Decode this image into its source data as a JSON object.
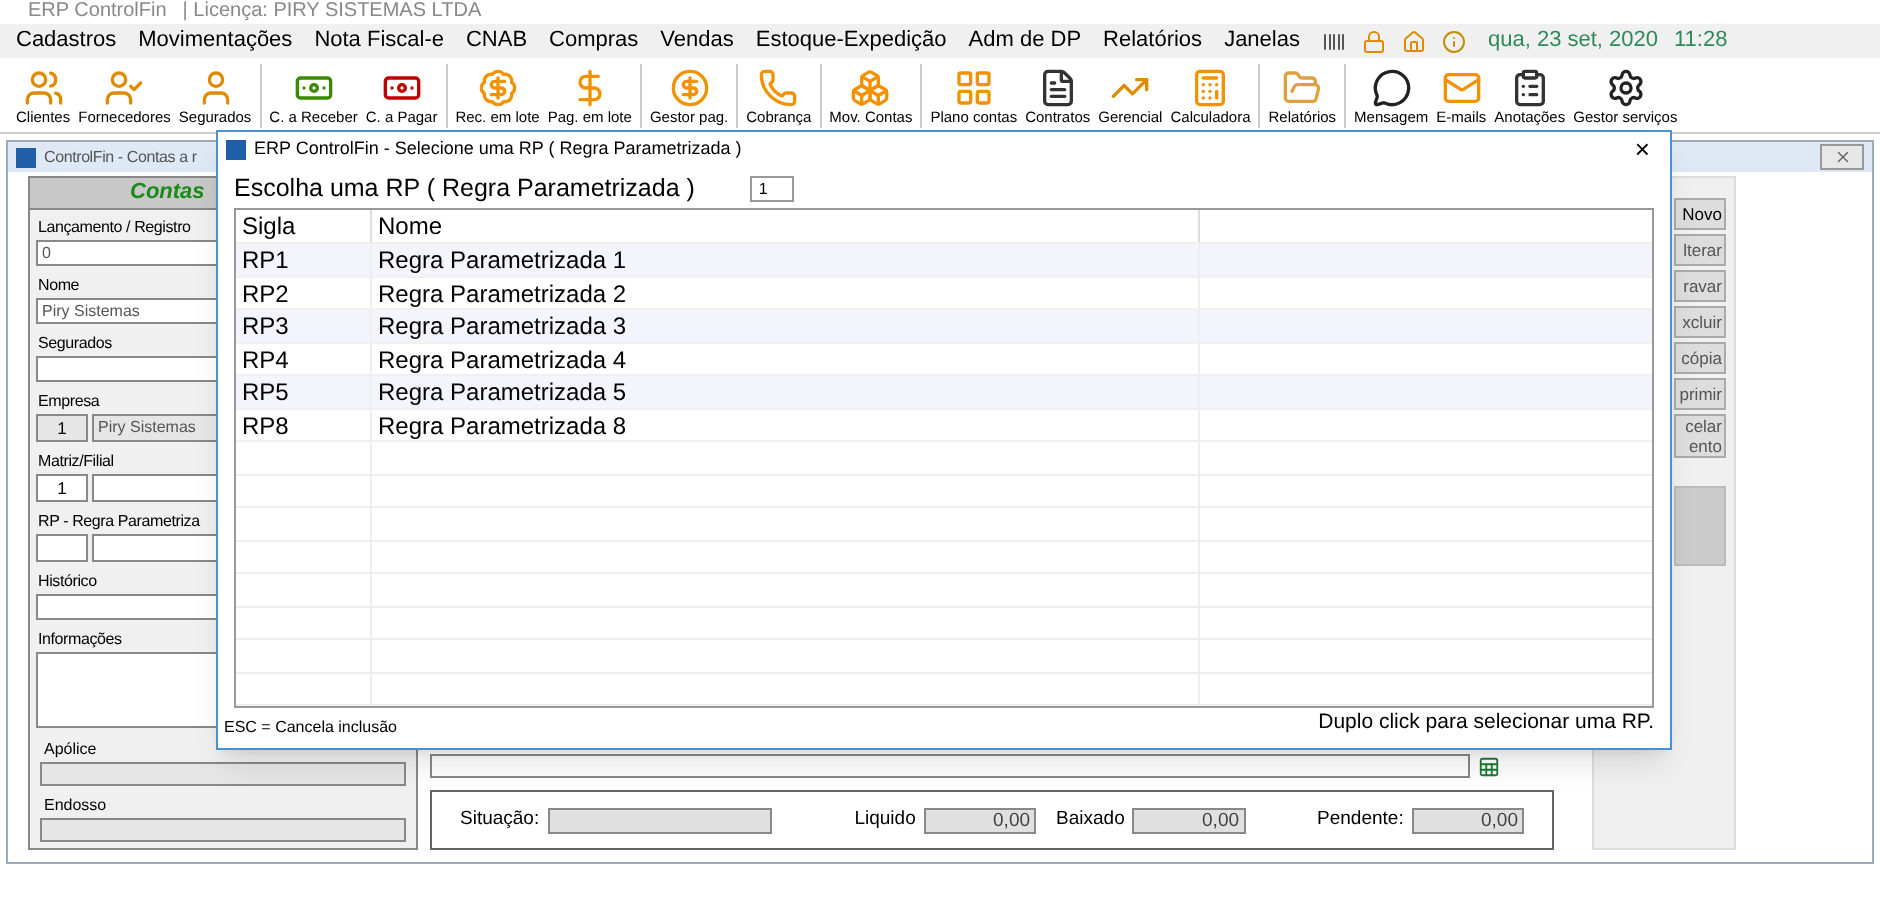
{
  "app": {
    "title": "ERP ControlFin",
    "license": "| Licença: PIRY SISTEMAS LTDA"
  },
  "menu": [
    "Cadastros",
    "Movimentações",
    "Nota Fiscal-e",
    "CNAB",
    "Compras",
    "Vendas",
    "Estoque-Expedição",
    "Adm de DP",
    "Relatórios",
    "Janelas"
  ],
  "datetime": {
    "date": "qua, 23 set, 2020",
    "time": "11:28"
  },
  "toolbar": [
    {
      "label": "Clientes",
      "separator_before": false
    },
    {
      "label": "Fornecedores",
      "separator_before": false
    },
    {
      "label": "Segurados",
      "separator_before": false
    },
    {
      "label": "C. a Receber",
      "separator_before": true
    },
    {
      "label": "C. a Pagar",
      "separator_before": false
    },
    {
      "label": "Rec. em lote",
      "separator_before": true
    },
    {
      "label": "Pag. em lote",
      "separator_before": false
    },
    {
      "label": "Gestor pag.",
      "separator_before": true
    },
    {
      "label": "Cobrança",
      "separator_before": true
    },
    {
      "label": "Mov. Contas",
      "separator_before": true
    },
    {
      "label": "Plano contas",
      "separator_before": true
    },
    {
      "label": "Contratos",
      "separator_before": false
    },
    {
      "label": "Gerencial",
      "separator_before": false
    },
    {
      "label": "Calculadora",
      "separator_before": false
    },
    {
      "label": "Relatórios",
      "separator_before": true
    },
    {
      "label": "Mensagem",
      "separator_before": true
    },
    {
      "label": "E-mails",
      "separator_before": false
    },
    {
      "label": "Anotações",
      "separator_before": false
    },
    {
      "label": "Gestor serviços",
      "separator_before": false
    }
  ],
  "child_window": {
    "title": "ControlFin -  Contas a r",
    "header": "Contas",
    "fields": [
      {
        "label": "Lançamento / Registro",
        "kind": "text",
        "value": "0",
        "disabled": false
      },
      {
        "label": "Nome",
        "kind": "text",
        "value": "Piry Sistemas",
        "disabled": false
      },
      {
        "label": "Segurados",
        "kind": "text",
        "disabled": false
      },
      {
        "label": "Empresa",
        "kind": "pair",
        "code": "1",
        "value": "Piry Sistemas",
        "disabled": true
      },
      {
        "label": "Matriz/Filial",
        "kind": "pair",
        "code": "1",
        "disabled": false
      },
      {
        "label": "RP - Regra Parametriza",
        "kind": "pair",
        "disabled": false
      },
      {
        "label": "Histórico",
        "kind": "text",
        "disabled": false
      },
      {
        "label": "Informações",
        "kind": "memo",
        "disabled": false
      }
    ],
    "lower_fields": [
      {
        "label": "Apólice",
        "disabled": true
      },
      {
        "label": "Endosso",
        "disabled": true
      }
    ],
    "buttons": [
      {
        "label": "Novo",
        "disabled": false
      },
      {
        "label": "lterar",
        "disabled": true
      },
      {
        "label": "ravar",
        "disabled": true
      },
      {
        "label": "xcluir",
        "disabled": true
      },
      {
        "label": "cópia",
        "disabled": true
      },
      {
        "label": "primir",
        "disabled": true
      },
      {
        "label": "celar ento",
        "disabled": true
      }
    ],
    "situation_label": "Situação:",
    "totals": [
      {
        "label": "Liquido",
        "value": "0,00"
      },
      {
        "label": "Baixado",
        "value": "0,00"
      },
      {
        "label": "Pendente:",
        "value": "0,00"
      }
    ]
  },
  "dialog": {
    "title": "ERP ControlFin - Selecione uma RP ( Regra Parametrizada )",
    "close": "×",
    "prompt": "Escolha uma RP ( Regra Parametrizada )",
    "input_value": "1",
    "columns": [
      "Sigla",
      "Nome"
    ],
    "rows": [
      {
        "sigla": "RP1",
        "nome": "Regra Parametrizada 1"
      },
      {
        "sigla": "RP2",
        "nome": "Regra Parametrizada 2"
      },
      {
        "sigla": "RP3",
        "nome": "Regra Parametrizada 3"
      },
      {
        "sigla": "RP4",
        "nome": "Regra Parametrizada 4"
      },
      {
        "sigla": "RP5",
        "nome": "Regra Parametrizada 5"
      },
      {
        "sigla": "RP8",
        "nome": "Regra Parametrizada 8"
      }
    ],
    "footer_left": "ESC = Cancela inclusão",
    "footer_right": "Duplo click para selecionar uma RP."
  }
}
